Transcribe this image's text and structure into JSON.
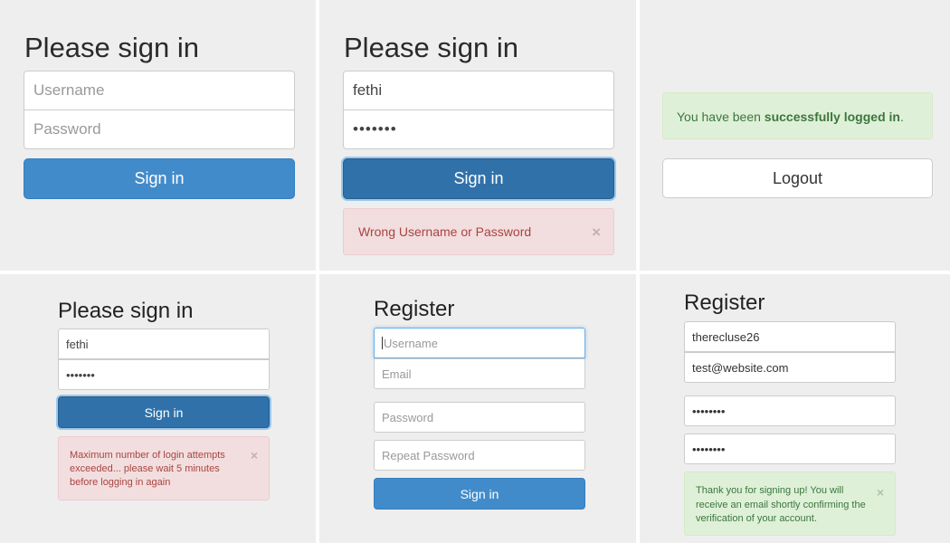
{
  "panels": {
    "signin_empty": {
      "title": "Please sign in",
      "username_placeholder": "Username",
      "password_placeholder": "Password",
      "button_label": "Sign in"
    },
    "signin_error": {
      "title": "Please sign in",
      "username_value": "fethi",
      "password_value": "•••••••",
      "button_label": "Sign in",
      "alert_text": "Wrong Username or Password",
      "close_glyph": "×"
    },
    "logged_in": {
      "alert_prefix": "You have been ",
      "alert_bold": "successfully logged in",
      "alert_suffix": ".",
      "logout_label": "Logout"
    },
    "signin_locked": {
      "title": "Please sign in",
      "username_value": "fethi",
      "password_value": "•••••••",
      "button_label": "Sign in",
      "alert_text": "Maximum number of login attempts exceeded... please wait 5 minutes before logging in again",
      "close_glyph": "×"
    },
    "register_empty": {
      "title": "Register",
      "username_placeholder": "Username",
      "email_placeholder": "Email",
      "password_placeholder": "Password",
      "repeat_password_placeholder": "Repeat Password",
      "button_label": "Sign in"
    },
    "register_success": {
      "title": "Register",
      "username_value": "therecluse26",
      "email_value": "test@website.com",
      "password_value": "••••••••",
      "repeat_password_value": "••••••••",
      "alert_text": "Thank you for signing up! You will receive an email shortly confirming the verification of your account.",
      "close_glyph": "×"
    }
  },
  "colors": {
    "primary": "#428bca",
    "primary_active": "#3071a9",
    "danger_bg": "#f2dede",
    "danger_text": "#a94442",
    "success_bg": "#dff0d8",
    "success_text": "#3c763d",
    "panel_bg": "#eeeeee"
  }
}
